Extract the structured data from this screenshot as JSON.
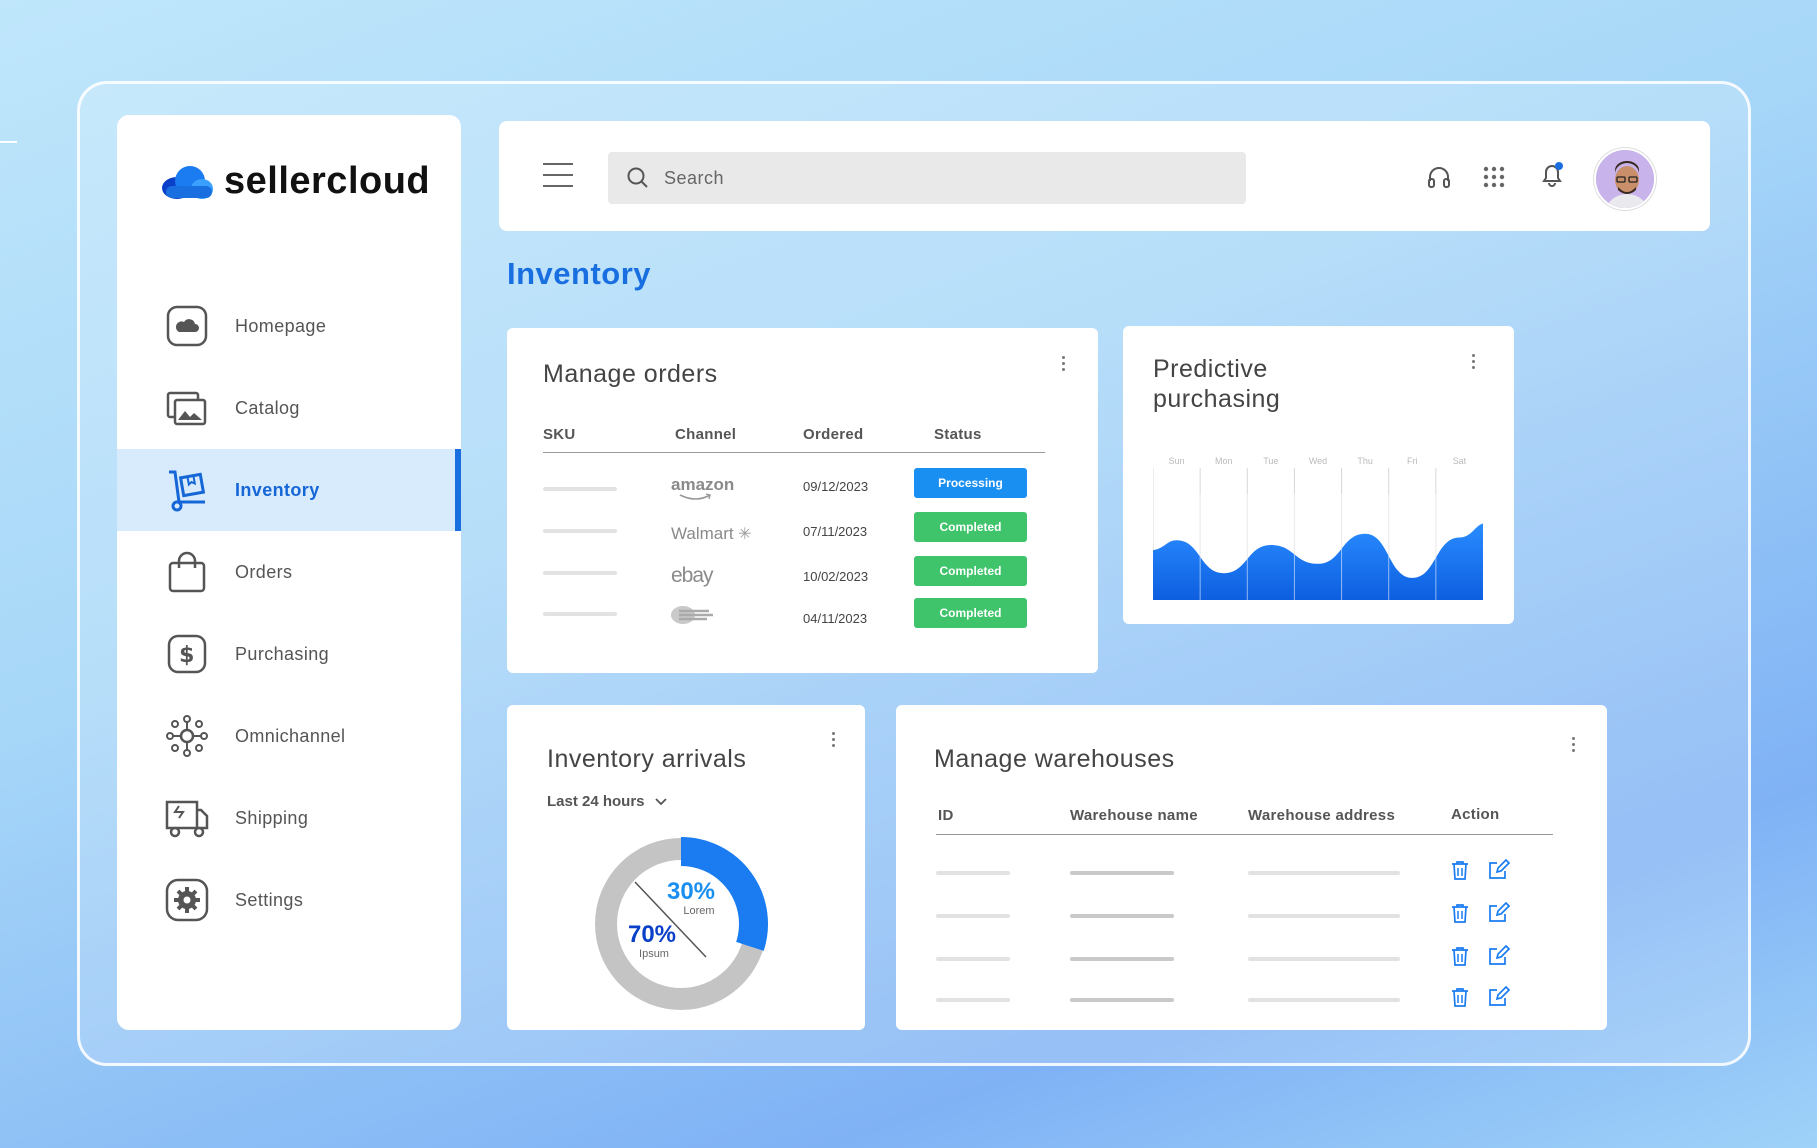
{
  "brand": {
    "name": "sellercloud"
  },
  "sidebar": {
    "items": [
      {
        "label": "Homepage",
        "icon": "home-cloud-icon",
        "active": false
      },
      {
        "label": "Catalog",
        "icon": "catalog-images-icon",
        "active": false
      },
      {
        "label": "Inventory",
        "icon": "hand-truck-icon",
        "active": true
      },
      {
        "label": "Orders",
        "icon": "shopping-bag-icon",
        "active": false
      },
      {
        "label": "Purchasing",
        "icon": "dollar-icon",
        "active": false
      },
      {
        "label": "Omnichannel",
        "icon": "network-icon",
        "active": false
      },
      {
        "label": "Shipping",
        "icon": "truck-icon",
        "active": false
      },
      {
        "label": "Settings",
        "icon": "gear-icon",
        "active": false
      }
    ]
  },
  "topbar": {
    "search_placeholder": "Search",
    "icons": [
      "menu-icon",
      "headset-icon",
      "apps-grid-icon",
      "bell-icon"
    ]
  },
  "page": {
    "title": "Inventory"
  },
  "manage_orders": {
    "title": "Manage orders",
    "columns": [
      "SKU",
      "Channel",
      "Ordered",
      "Status"
    ],
    "rows": [
      {
        "channel": "amazon",
        "ordered": "09/12/2023",
        "status": "Processing"
      },
      {
        "channel": "Walmart",
        "ordered": "07/11/2023",
        "status": "Completed"
      },
      {
        "channel": "ebay",
        "ordered": "10/02/2023",
        "status": "Completed"
      },
      {
        "channel": "",
        "ordered": "04/11/2023",
        "status": "Completed"
      }
    ]
  },
  "predictive": {
    "title_line1": "Predictive",
    "title_line2": "purchasing"
  },
  "chart_data": {
    "type": "area",
    "categories": [
      "Sun",
      "Mon",
      "Tue",
      "Wed",
      "Thu",
      "Fri",
      "Sat"
    ],
    "series": [
      {
        "values": [
          0.55,
          0.2,
          0.5,
          0.3,
          0.62,
          0.15,
          0.58
        ]
      }
    ],
    "title": "",
    "color": "#1a7cf0"
  },
  "arrivals": {
    "title": "Inventory arrivals",
    "period": "Last 24 hours",
    "donut": {
      "slices": [
        {
          "value": 30,
          "label": "30%",
          "sublabel": "Lorem",
          "color": "#1a7cf0"
        },
        {
          "value": 70,
          "label": "70%",
          "sublabel": "Ipsum",
          "color": "#c4c4c4"
        }
      ]
    }
  },
  "warehouses": {
    "title": "Manage warehouses",
    "columns": [
      "ID",
      "Warehouse name",
      "Warehouse address",
      "Action"
    ],
    "row_count": 4
  }
}
